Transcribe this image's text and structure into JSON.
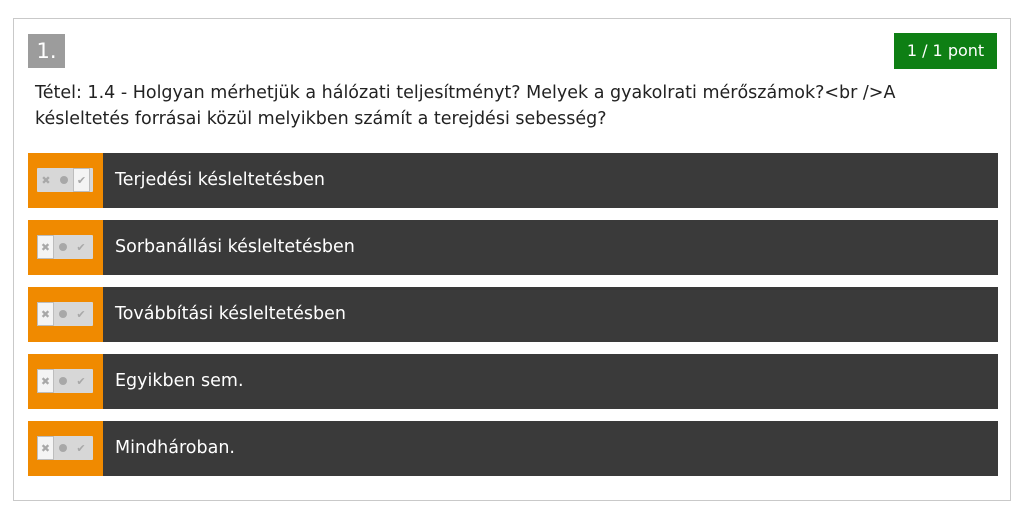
{
  "question": {
    "number": "1.",
    "score": "1 / 1 pont",
    "text": "Tétel: 1.4 - Holgyan mérhetjük a hálózati teljesítményt? Melyek a gyakolrati mérőszámok?<br />A késleltetés forrásai közül melyikben számít a terejdési sebesség?"
  },
  "answers": [
    {
      "label": "Terjedési késleltetésben",
      "state": "check"
    },
    {
      "label": "Sorbanállási késleltetésben",
      "state": "cross"
    },
    {
      "label": "Továbbítási késleltetésben",
      "state": "cross"
    },
    {
      "label": "Egyikben sem.",
      "state": "cross"
    },
    {
      "label": "Mindhároban.",
      "state": "cross"
    }
  ],
  "icons": {
    "cross": "cross-icon",
    "neutral": "dot-icon",
    "check": "check-icon"
  },
  "colors": {
    "accent": "#f08a00",
    "answer_bg": "#3a3a3a",
    "score_bg": "#0e7f14",
    "number_bg": "#9c9c9c"
  }
}
